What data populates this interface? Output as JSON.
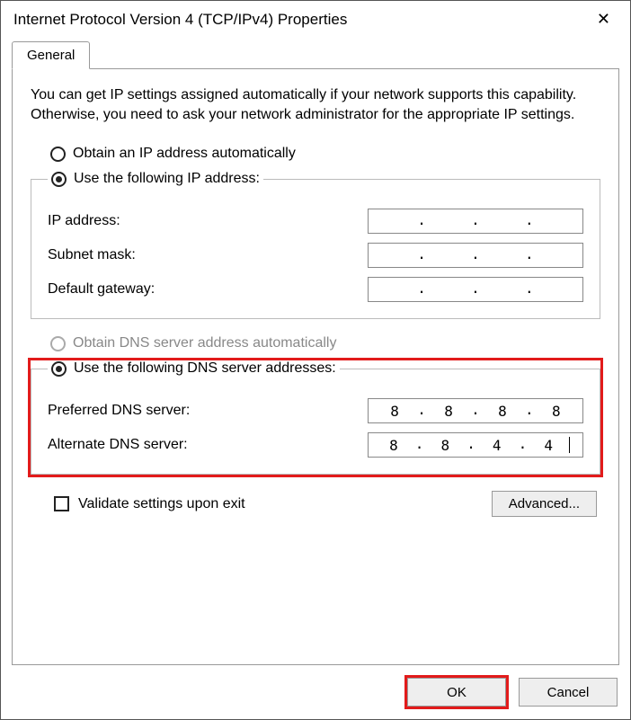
{
  "window": {
    "title": "Internet Protocol Version 4 (TCP/IPv4) Properties"
  },
  "tab": {
    "general": "General"
  },
  "explain": "You can get IP settings assigned automatically if your network supports this capability. Otherwise, you need to ask your network administrator for the appropriate IP settings.",
  "ip": {
    "auto_label": "Obtain an IP address automatically",
    "manual_label": "Use the following IP address:",
    "address_label": "IP address:",
    "subnet_label": "Subnet mask:",
    "gateway_label": "Default gateway:",
    "address": [
      "",
      "",
      "",
      ""
    ],
    "subnet": [
      "",
      "",
      "",
      ""
    ],
    "gateway": [
      "",
      "",
      "",
      ""
    ]
  },
  "dns": {
    "auto_label": "Obtain DNS server address automatically",
    "manual_label": "Use the following DNS server addresses:",
    "preferred_label": "Preferred DNS server:",
    "alternate_label": "Alternate DNS server:",
    "preferred": [
      "8",
      "8",
      "8",
      "8"
    ],
    "alternate": [
      "8",
      "8",
      "4",
      "4"
    ]
  },
  "validate_label": "Validate settings upon exit",
  "advanced_label": "Advanced...",
  "buttons": {
    "ok": "OK",
    "cancel": "Cancel"
  }
}
